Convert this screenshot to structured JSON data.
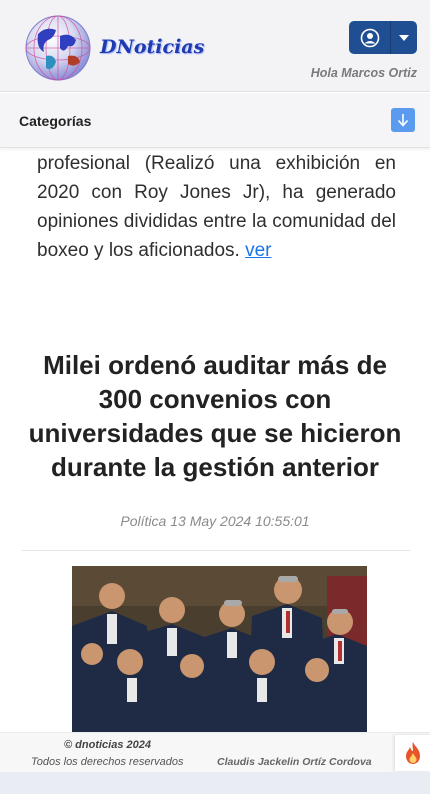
{
  "header": {
    "brand": "DNoticias",
    "greeting": "Hola Marcos Ortiz",
    "logo_icon": "globe-logo-icon",
    "user_icon": "user-circle-icon",
    "caret_icon": "caret-down-icon",
    "accent": "#1f4f92"
  },
  "categories": {
    "label": "Categorías",
    "toggle_icon": "arrow-down-icon",
    "toggle_color": "#5b9bef"
  },
  "excerpt": {
    "text": "que también incluye a Adam Sandler, Margot Robbie y al regreso al ring tras casi dos décadas de su última pelea profesional (Realizó una exhibición en 2020 con Roy Jones Jr), ha generado opiniones divididas entre la comunidad del boxeo y los aficionados.",
    "link_label": "ver"
  },
  "article": {
    "title": "Milei ordenó auditar más de 300 convenios con universidades que se hicieron durante la gestión anterior",
    "category": "Política",
    "date": "13 May 2024 10:55:01"
  },
  "footer": {
    "copyright": "© dnoticias 2024",
    "rights": "Todos los derechos reservados",
    "author": "Claudis Jackelin Ortíz Cordova",
    "fire_icon": "fire-icon"
  }
}
